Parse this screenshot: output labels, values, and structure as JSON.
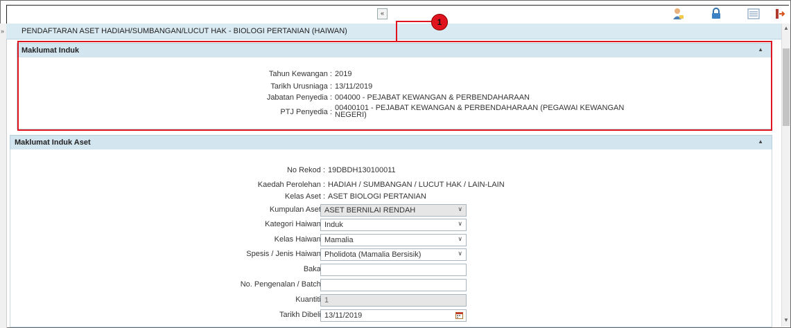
{
  "toolbar": {
    "collapse_glyph": "«",
    "icons": [
      "user-icon",
      "lock-icon",
      "list-icon",
      "exit-icon"
    ]
  },
  "page_title": "PENDAFTARAN ASET HADIAH/SUMBANGAN/LUCUT HAK - BIOLOGI PERTANIAN (HAIWAN)",
  "callout": {
    "number": "1",
    "color": "#e0141e"
  },
  "maklumat_induk": {
    "header": "Maklumat Induk",
    "fields": [
      {
        "label": "Tahun Kewangan :",
        "value": "2019"
      },
      {
        "label": "Tarikh Urusniaga :",
        "value": "13/11/2019"
      },
      {
        "label": "Jabatan Penyedia :",
        "value": "004000 - PEJABAT KEWANGAN & PERBENDAHARAAN"
      },
      {
        "label": "PTJ Penyedia :",
        "value_line1": "00400101 - PEJABAT KEWANGAN & PERBENDAHARAAN (PEGAWAI KEWANGAN",
        "value_line2": "NEGERI)"
      }
    ]
  },
  "maklumat_induk_aset": {
    "header": "Maklumat Induk Aset",
    "no_rekod": {
      "label": "No Rekod :",
      "value": "19DBDH130100011"
    },
    "kaedah": {
      "label": "Kaedah Perolehan :",
      "value": "HADIAH / SUMBANGAN / LUCUT HAK / LAIN-LAIN"
    },
    "kelas_aset": {
      "label": "Kelas Aset :",
      "value": "ASET BIOLOGI PERTANIAN"
    },
    "kumpulan_aset": {
      "label": "Kumpulan Aset :",
      "value": "ASET BERNILAI RENDAH"
    },
    "kategori": {
      "label": "Kategori Haiwan :",
      "value": "Induk"
    },
    "kelas_haiwan": {
      "label": "Kelas Haiwan :",
      "value": "Mamalia"
    },
    "spesis": {
      "label": "Spesis / Jenis Haiwan :",
      "value": "Pholidota (Mamalia Bersisik)"
    },
    "baka": {
      "label": "Baka :",
      "value": ""
    },
    "pengenalan": {
      "label": "No. Pengenalan / Batch :",
      "value": ""
    },
    "kuantiti": {
      "label": "Kuantiti :",
      "value": "1"
    },
    "tarikh_dibeli": {
      "label": "Tarikh Dibeli :",
      "value": "13/11/2019"
    }
  }
}
